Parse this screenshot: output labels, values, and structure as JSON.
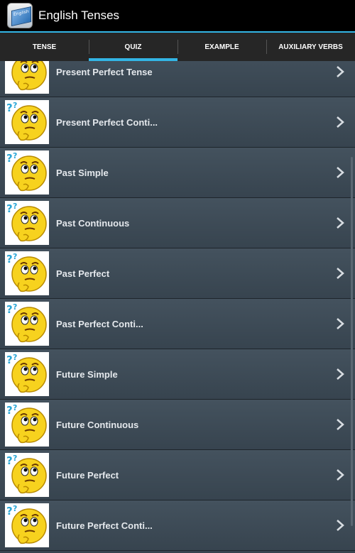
{
  "app": {
    "title": "English Tenses",
    "icon_name": "app-book-icon",
    "icon_text": "English"
  },
  "tabs": [
    {
      "label": "TENSE",
      "selected": false
    },
    {
      "label": "QUIZ",
      "selected": true
    },
    {
      "label": "EXAMPLE",
      "selected": false
    },
    {
      "label": "AUXILIARY VERBS",
      "selected": false
    }
  ],
  "list": {
    "items": [
      {
        "label": "Present Perfect Tense",
        "icon": "thinking-face-icon"
      },
      {
        "label": "Present Perfect Conti...",
        "icon": "thinking-face-icon"
      },
      {
        "label": "Past Simple",
        "icon": "thinking-face-icon"
      },
      {
        "label": "Past Continuous",
        "icon": "thinking-face-icon"
      },
      {
        "label": "Past Perfect",
        "icon": "thinking-face-icon"
      },
      {
        "label": "Past Perfect Conti...",
        "icon": "thinking-face-icon"
      },
      {
        "label": "Future Simple",
        "icon": "thinking-face-icon"
      },
      {
        "label": "Future Continuous",
        "icon": "thinking-face-icon"
      },
      {
        "label": "Future Perfect",
        "icon": "thinking-face-icon"
      },
      {
        "label": "Future Perfect Conti...",
        "icon": "thinking-face-icon"
      }
    ]
  },
  "colors": {
    "accent": "#33b5e5",
    "actionbar": "#000000",
    "tabbar": "#262626",
    "list_bg": "#37444f"
  }
}
